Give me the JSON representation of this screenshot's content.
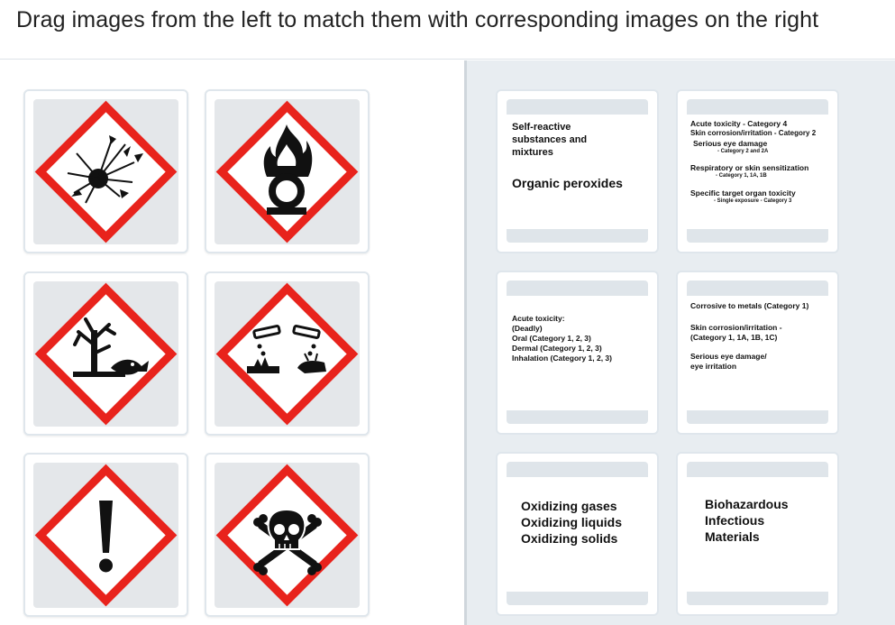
{
  "instruction": "Drag images from the left to match them with corresponding images on the right",
  "pictograms": [
    {
      "icon": "exploding-bomb-icon"
    },
    {
      "icon": "flame-over-circle-icon"
    },
    {
      "icon": "environment-icon"
    },
    {
      "icon": "corrosion-icon"
    },
    {
      "icon": "exclamation-mark-icon"
    },
    {
      "icon": "skull-and-crossbones-icon"
    }
  ],
  "targets": [
    {
      "lines": [
        "Self-reactive",
        "substances and",
        "mixtures",
        "Organic peroxides"
      ]
    },
    {
      "lines": [
        "Acute toxicity - Category 4",
        "Skin corrosion/irritation - Category 2",
        "Serious eye damage",
        "- Category 2 and 2A",
        "Respiratory or skin sensitization",
        "- Category 1, 1A, 1B",
        "Specific target organ toxicity",
        "- Single exposure - Category 3"
      ]
    },
    {
      "lines": [
        "Acute toxicity:",
        "(Deadly)",
        "Oral (Category 1, 2, 3)",
        "Dermal (Category 1, 2, 3)",
        "Inhalation (Category 1, 2, 3)"
      ]
    },
    {
      "lines": [
        "Corrosive to metals (Category 1)",
        "Skin corrosion/irritation -",
        "(Category 1, 1A, 1B, 1C)",
        "Serious eye damage/",
        "eye irritation"
      ]
    },
    {
      "lines": [
        "Oxidizing gases",
        "Oxidizing liquids",
        "Oxidizing solids"
      ]
    },
    {
      "lines": [
        "Biohazardous",
        "Infectious",
        "Materials"
      ]
    }
  ],
  "colors": {
    "hazard_red": "#e8231c",
    "pane_bg": "#e8edf1",
    "card_border": "#dfe6ec"
  }
}
